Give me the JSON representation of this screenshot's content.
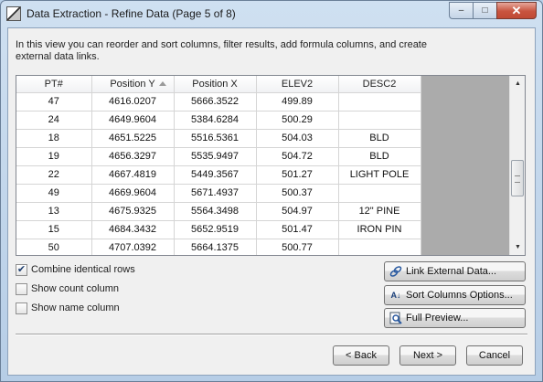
{
  "window": {
    "title": "Data Extraction - Refine Data (Page 5 of 8)",
    "icons": {
      "app": "data-extraction-icon",
      "minimize": "minimize-icon",
      "maximize": "maximize-icon",
      "close": "close-icon"
    },
    "caption": {
      "minimize": "–",
      "maximize": "□",
      "close": "✕"
    }
  },
  "instructions": "In this view you can reorder and sort columns, filter results, add formula columns, and create external data links.",
  "table": {
    "columns": [
      "PT#",
      "Position Y",
      "Position X",
      "ELEV2",
      "DESC2"
    ],
    "sort_icon": "sort-ascending-icon",
    "rows": [
      [
        "47",
        "4616.0207",
        "5666.3522",
        "499.89",
        ""
      ],
      [
        "24",
        "4649.9604",
        "5384.6284",
        "500.29",
        ""
      ],
      [
        "18",
        "4651.5225",
        "5516.5361",
        "504.03",
        "BLD"
      ],
      [
        "19",
        "4656.3297",
        "5535.9497",
        "504.72",
        "BLD"
      ],
      [
        "22",
        "4667.4819",
        "5449.3567",
        "501.27",
        "LIGHT POLE"
      ],
      [
        "49",
        "4669.9604",
        "5671.4937",
        "500.37",
        ""
      ],
      [
        "13",
        "4675.9325",
        "5564.3498",
        "504.97",
        "12\" PINE"
      ],
      [
        "15",
        "4684.3432",
        "5652.9519",
        "501.47",
        "IRON PIN"
      ],
      [
        "50",
        "4707.0392",
        "5664.1375",
        "500.77",
        ""
      ]
    ]
  },
  "options": {
    "combine": {
      "label": "Combine identical rows",
      "checked": true
    },
    "count": {
      "label": "Show count column",
      "checked": false
    },
    "name": {
      "label": "Show name column",
      "checked": false
    }
  },
  "side_buttons": {
    "link": {
      "label": "Link External Data...",
      "icon": "link-icon"
    },
    "sort": {
      "label": "Sort Columns Options...",
      "icon": "sort-az-icon"
    },
    "preview": {
      "label": "Full Preview...",
      "icon": "preview-icon"
    }
  },
  "footer": {
    "back": "< Back",
    "next": "Next >",
    "cancel": "Cancel"
  },
  "colors": {
    "frame": "#b9d1ea",
    "client": "#f0f0f0",
    "close": "#c8543f",
    "grid_empty": "#ababab"
  }
}
